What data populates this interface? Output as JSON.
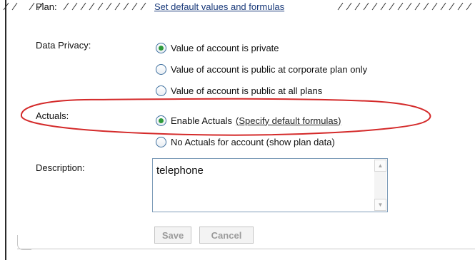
{
  "form": {
    "plan": {
      "label": "Plan:",
      "link": "Set default values and formulas"
    },
    "data_privacy": {
      "label": "Data Privacy:",
      "options": [
        {
          "label": "Value of account is private",
          "checked": true
        },
        {
          "label": "Value of account is public at corporate plan only",
          "checked": false
        },
        {
          "label": "Value of account is public at all plans",
          "checked": false
        }
      ]
    },
    "actuals": {
      "label": "Actuals:",
      "options": [
        {
          "label": "Enable Actuals",
          "link": "(Specify default formulas)",
          "checked": true
        },
        {
          "label": "No Actuals for account (show plan data)",
          "checked": false
        }
      ]
    },
    "description": {
      "label": "Description:",
      "value": "telephone"
    },
    "buttons": {
      "save": "Save",
      "cancel": "Cancel"
    }
  },
  "colors": {
    "highlight_ellipse": "#d42a2a",
    "link": "#1a3a7a",
    "radio_checked": "#2f9a3c"
  }
}
